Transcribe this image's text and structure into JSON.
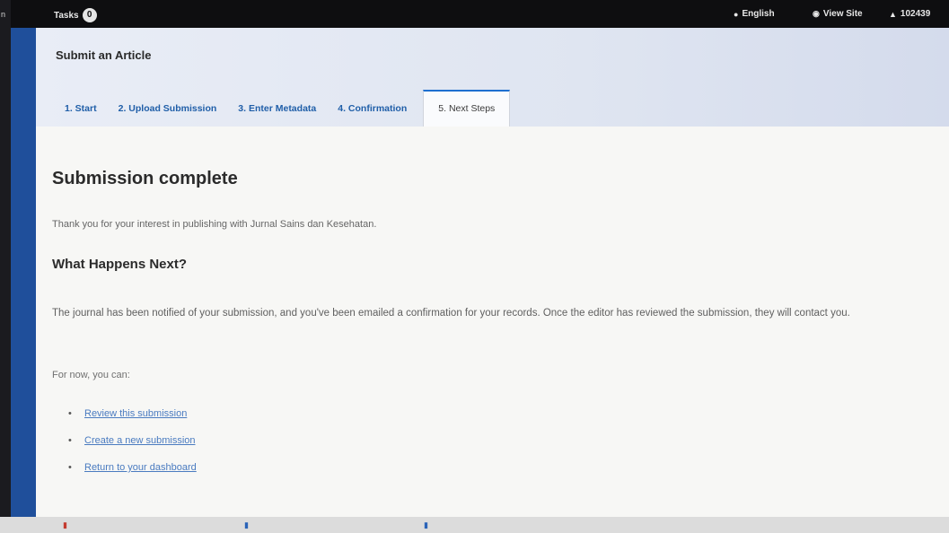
{
  "topbar": {
    "tasks_label": "Tasks",
    "tasks_count": "0",
    "language_label": "English",
    "view_site_label": "View Site",
    "user_label": "102439"
  },
  "header": {
    "title": "Submit an Article",
    "tabs": [
      {
        "label": "1. Start"
      },
      {
        "label": "2. Upload Submission"
      },
      {
        "label": "3. Enter Metadata"
      },
      {
        "label": "4. Confirmation"
      },
      {
        "label": "5. Next Steps",
        "active": true
      }
    ]
  },
  "content": {
    "heading": "Submission complete",
    "thanks_text": "Thank you for your interest in publishing with Jurnal Sains dan Kesehatan.",
    "subheading": "What Happens Next?",
    "paragraph": "The journal has been notified of your submission, and you've been emailed a confirmation for your records. Once the editor has reviewed the submission, they will contact you.",
    "for_now": "For now, you can:",
    "links": [
      {
        "label": "Review this submission"
      },
      {
        "label": "Create a new submission"
      },
      {
        "label": "Return to your dashboard"
      }
    ]
  },
  "colors": {
    "sidebar": "#1f4f9b",
    "link": "#4a7bc0",
    "tab_text": "#1f5ea8",
    "active_tab_border": "#1e6fd0"
  },
  "icons": {
    "language": "globe-icon",
    "view_site": "eye-icon",
    "user": "user-icon"
  }
}
